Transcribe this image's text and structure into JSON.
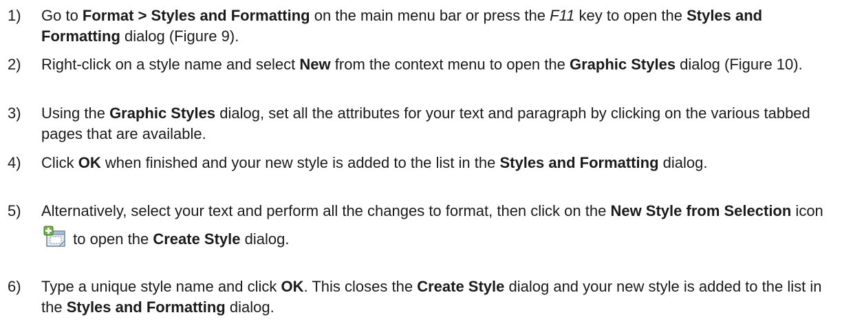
{
  "steps": [
    {
      "num": "1)",
      "parts": [
        [
          "t",
          "Go to "
        ],
        [
          "b",
          "Format > Styles and Formatting"
        ],
        [
          "t",
          " on the main menu bar or press the "
        ],
        [
          "i",
          "F11"
        ],
        [
          "t",
          " key to open the "
        ],
        [
          "b",
          "Styles and Formatting"
        ],
        [
          "t",
          " dialog (Figure 9)."
        ]
      ]
    },
    {
      "num": "2)",
      "parts": [
        [
          "t",
          "Right-click on a style name and select "
        ],
        [
          "b",
          "New"
        ],
        [
          "t",
          " from the context menu to open the "
        ],
        [
          "b",
          "Graphic Styles"
        ],
        [
          "t",
          " dialog (Figure 10)."
        ]
      ]
    },
    {
      "num": "3)",
      "parts": [
        [
          "t",
          "Using the "
        ],
        [
          "b",
          "Graphic Styles"
        ],
        [
          "t",
          " dialog, set all the attributes for your text and paragraph by clicking on the various tabbed pages that are available."
        ]
      ]
    },
    {
      "num": "4)",
      "parts": [
        [
          "t",
          "Click "
        ],
        [
          "b",
          "OK"
        ],
        [
          "t",
          " when finished and your new style is added to the list in the "
        ],
        [
          "b",
          "Styles and Formatting"
        ],
        [
          "t",
          " dialog."
        ]
      ]
    },
    {
      "num": "5)",
      "parts": [
        [
          "t",
          "Alternatively, select your text and perform all the changes to format, then click on the "
        ],
        [
          "b",
          "New Style from Selection"
        ],
        [
          "t",
          " icon "
        ],
        [
          "icon",
          "new-style-from-selection-icon"
        ],
        [
          "t",
          " to open the "
        ],
        [
          "b",
          "Create Style"
        ],
        [
          "t",
          " dialog."
        ]
      ]
    },
    {
      "num": "6)",
      "parts": [
        [
          "t",
          "Type a unique style name and click "
        ],
        [
          "b",
          "OK"
        ],
        [
          "t",
          ". This closes the "
        ],
        [
          "b",
          "Create Style"
        ],
        [
          "t",
          " dialog and your new style is added to the list in the "
        ],
        [
          "b",
          "Styles and Formatting"
        ],
        [
          "t",
          " dialog."
        ]
      ]
    }
  ]
}
